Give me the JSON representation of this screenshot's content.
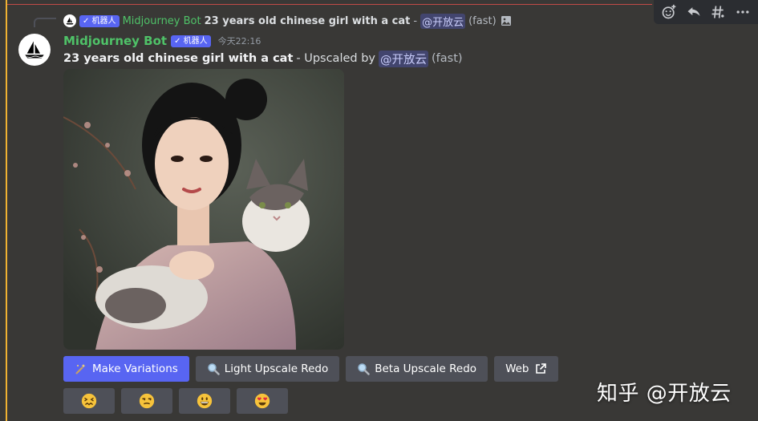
{
  "reply": {
    "badge": "✓ 机器人",
    "author": "Midjourney Bot",
    "prompt": "23 years old chinese girl with a cat",
    "dash": " - ",
    "mention": "@开放云",
    "speed": "(fast)"
  },
  "message": {
    "author": "Midjourney Bot",
    "badge": "✓ 机器人",
    "timestamp": "今天22:16",
    "prompt": "23 years old chinese girl with a cat",
    "action_text": "- Upscaled by",
    "mention": "@开放云",
    "speed": "(fast)"
  },
  "buttons": [
    {
      "label": "Make Variations",
      "icon": "magic-wand-icon"
    },
    {
      "label": "Light Upscale Redo",
      "icon": "magnifier-icon"
    },
    {
      "label": "Beta Upscale Redo",
      "icon": "magnifier-icon"
    },
    {
      "label": "Web",
      "icon": "external-link-icon"
    }
  ],
  "emoji_reactions": [
    "confounded-face",
    "unamused-face",
    "grinning-face",
    "heart-eyes-face"
  ],
  "toolbar_icons": [
    "add-reaction-icon",
    "reply-icon",
    "create-thread-icon",
    "more-icon"
  ],
  "watermark": "知乎 @开放云",
  "colors": {
    "background": "#393836",
    "accent_bar": "#f0b232",
    "author": "#4fc268",
    "primary_button": "#5865f2",
    "secondary_button": "#4e5058"
  }
}
